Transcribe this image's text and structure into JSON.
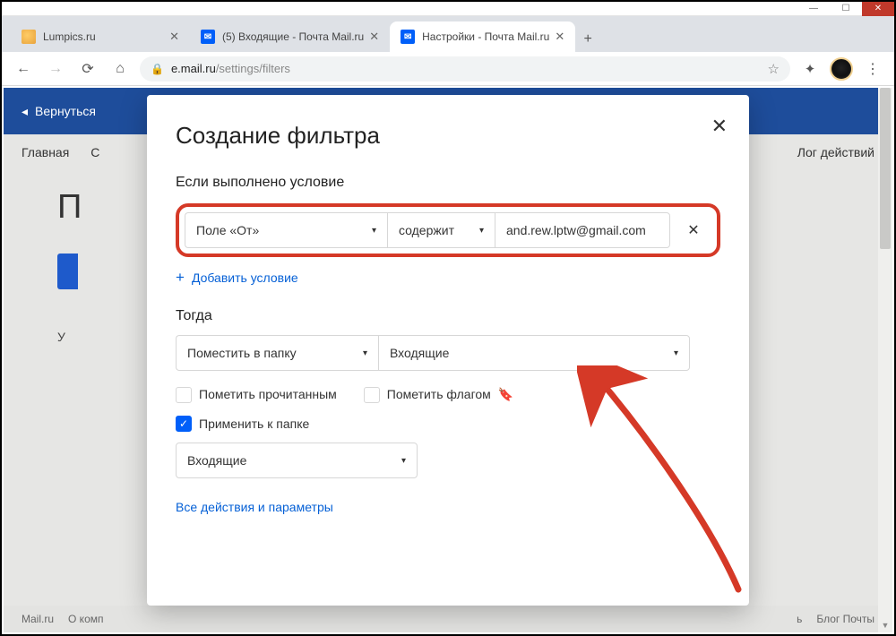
{
  "window": {
    "minimize": "—",
    "maximize": "☐",
    "close": "✕"
  },
  "tabs": [
    {
      "title": "Lumpics.ru"
    },
    {
      "title": "(5) Входящие - Почта Mail.ru"
    },
    {
      "title": "Настройки - Почта Mail.ru"
    }
  ],
  "newtab": "+",
  "nav": {
    "back": "←",
    "forward": "→",
    "reload": "⟳",
    "home": "⌂"
  },
  "url": {
    "host": "e.mail.ru",
    "path": "/settings/filters"
  },
  "toolbar": {
    "star": "☆",
    "ext": "✦",
    "menu": "⋮"
  },
  "bluebar": {
    "back_caret": "◂",
    "back_label": "Вернуться"
  },
  "subnav": {
    "left": "Главная",
    "left2": "С",
    "right": "Лог действий"
  },
  "main": {
    "h1_first": "П",
    "sub_first": "У"
  },
  "footer": {
    "left1": "Mail.ru",
    "left2": "О комп",
    "right1": "ь",
    "right2": "Блог Почты"
  },
  "modal": {
    "title": "Создание фильтра",
    "close": "✕",
    "if_label": "Если выполнено условие",
    "field_from": "Поле «От»",
    "op": "содержит",
    "value": "and.rew.lptw@gmail.com",
    "remove": "✕",
    "add_cond": "Добавить условие",
    "then": "Тогда",
    "action": "Поместить в папку",
    "folder": "Входящие",
    "mark_read": "Пометить прочитанным",
    "mark_flag": "Пометить флагом",
    "apply_folder": "Применить к папке",
    "apply_folder_value": "Входящие",
    "all_actions": "Все действия и параметры",
    "caret": "▾",
    "plus": "+",
    "check": "✓",
    "flag": "◣"
  }
}
